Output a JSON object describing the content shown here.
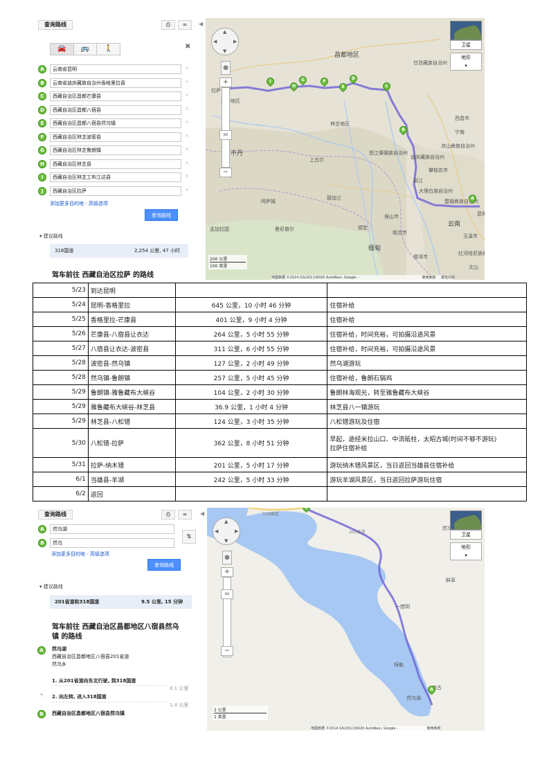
{
  "colors": {
    "route": "#6b62d6",
    "marker": "#6fbf3f",
    "button": "#4d90fe",
    "water": "#a7c8f2",
    "link": "#1155cc"
  },
  "shot1": {
    "panel": {
      "route_button": "查询路线",
      "print_icon": "print-icon",
      "link_icon": "link-icon",
      "modes": [
        "car-icon",
        "bus-icon",
        "walk-icon"
      ],
      "close_label": "✖",
      "waypoints": [
        {
          "letter": "A",
          "value": "云南省昆明"
        },
        {
          "letter": "B",
          "value": "云南省迪庆藏族自治州香格里拉县"
        },
        {
          "letter": "C",
          "value": "西藏自治区昌都芒康县"
        },
        {
          "letter": "D",
          "value": "西藏自治区昌都八宿县"
        },
        {
          "letter": "E",
          "value": "西藏自治区昌都八宿县然乌镇"
        },
        {
          "letter": "F",
          "value": "西藏自治区林芝波密县"
        },
        {
          "letter": "G",
          "value": "西藏自治区林芝鲁朗镇"
        },
        {
          "letter": "H",
          "value": "西藏自治区林芝县"
        },
        {
          "letter": "I",
          "value": "西藏自治区林芝工布江达县"
        },
        {
          "letter": "J",
          "value": "西藏自治区拉萨"
        }
      ],
      "add_destination": "添加更多目的地",
      "advanced": "高级选项",
      "search_button": "查询路线",
      "suggested": "建议路线",
      "route_name": "318国道",
      "route_summary": "2,254 公里, 47 小时",
      "drive_title": "驾车前往 西藏自治区拉萨 的路线"
    },
    "map": {
      "satellite": "卫星",
      "terrain": "地形",
      "scale_top": "200 公里",
      "scale_bottom": "100 英里",
      "footer": "地图数据 ©2014 GS(2011)6020 AutoNavi, Google -",
      "footer_right": "使用条款",
      "footer_report": "报告问题",
      "places": {
        "changdu": "昌都地区",
        "lasa": "拉萨",
        "shannan": "山南地区",
        "linzhi": "林芝地区",
        "lijiang": "丽江",
        "kunming": "昆明",
        "yunnan": "云南",
        "burma": "缅甸",
        "bhutan": "不丹",
        "dali": "大理白族自治州",
        "diqing": "迪庆藏族自治州",
        "yushu": "玉溪市",
        "xichang": "西昌市",
        "lhunze": "阿萨姆",
        "nagaland": "那加兰",
        "manipur": "曼尼普尔",
        "bangladesh": "孟加拉国",
        "dulong": "怒江傈僳族自治州",
        "ningnan": "宁南",
        "chuxiong": "楚雄彝族自治州",
        "honghe": "红河哈尼族彝族自治州",
        "puer": "普洱市",
        "sichuan": "凉山彝族自治州",
        "panzhihua": "攀枝花市",
        "ganzi": "甘孜藏族自治州",
        "shanggu": "上古尔",
        "baoshan": "保山市",
        "lincang": "临沧市",
        "dehong": "德宏",
        "wenshan": "文山"
      }
    }
  },
  "itinerary": [
    {
      "date": "5/23",
      "route": "到达昆明",
      "distance": "",
      "note": ""
    },
    {
      "date": "5/24",
      "route": "昆明-香格里拉",
      "distance": "645 公里，10 小时 46 分钟",
      "note": "住宿补给"
    },
    {
      "date": "5/25",
      "route": "香格里拉-芒康县",
      "distance": "401 公里，9 小时 4 分钟",
      "note": "住宿补给"
    },
    {
      "date": "5/26",
      "route": "芒康县-八宿县让衣达",
      "distance": "264 公里，5 小时 55 分钟",
      "note": "住宿补给，时间充裕，可拍摄沿途风景"
    },
    {
      "date": "5/27",
      "route": "八宿县让衣达-波密县",
      "distance": "311 公里，6 小时 55 分钟",
      "note": "住宿补给，时间充裕，可拍摄沿途风景"
    },
    {
      "date": "5/28",
      "route": "波密县-然乌镇",
      "distance": "127 公里，2 小时 49 分钟",
      "note": "然乌湖游玩"
    },
    {
      "date": "5/28",
      "route": "然乌镇-鲁朗镇",
      "distance": "257 公里，5 小时 45 分钟",
      "note": "住宿补给，鲁朗石锅鸡"
    },
    {
      "date": "5/29",
      "route": "鲁朗镇-雅鲁藏布大峡谷",
      "distance": "104 公里，2 小时 30 分钟",
      "note": "鲁朗林海观光，转至雅鲁藏布大峡谷"
    },
    {
      "date": "5/29",
      "route": "雅鲁藏布大峡谷-林芝县",
      "distance": "36.9 公里，1 小时 4 分钟",
      "note": "林芝县八一镇游玩"
    },
    {
      "date": "5/29",
      "route": "林芝县-八松错",
      "distance": "124 公里，3 小时 35 分钟",
      "note": "八松错游玩及住宿"
    },
    {
      "date": "5/30",
      "route": "八松错-拉萨",
      "distance": "362 公里，8 小时 51 分钟",
      "note": "早起，途经米拉山口、中流砥柱，太昭古城(时间不够不游玩)",
      "note2": "拉萨住宿补给"
    },
    {
      "date": "5/31",
      "route": "拉萨-纳木错",
      "distance": "201 公里，5 小时 17 分钟",
      "note": "游玩纳木错风景区，当日返回当雄县住宿补给"
    },
    {
      "date": "6/1",
      "route": "当雄县-羊湖",
      "distance": "242 公里，5 小时 33 分钟",
      "note": "游玩羊湖风景区，当日返回拉萨游玩住宿"
    },
    {
      "date": "6/2",
      "route": "返回",
      "distance": "",
      "note": ""
    }
  ],
  "shot2": {
    "panel": {
      "route_button": "查询路线",
      "waypoints": [
        {
          "letter": "A",
          "value": "然乌湖"
        },
        {
          "letter": "B",
          "value": "然乌"
        }
      ],
      "swap_icon": "swap-icon",
      "add_destination": "添加更多目的地",
      "advanced": "高级选项",
      "search_button": "查询路线",
      "suggested": "建议路线",
      "route_name": "201省道和318国道",
      "route_summary": "9.5 公里, 15 分钟",
      "drive_title_1": "驾车前往 西藏自治区昌都地区八宿县然乌",
      "drive_title_2": "镇 的路线",
      "start_name": "然乌湖",
      "start_addr_1": "西藏自治区昌都地区八宿县201省道",
      "start_addr_2": "然乌乡",
      "step1": "1. 从201省道向东北行驶, 到318国道",
      "step1_dist": "8.1 公里",
      "step2": "2. 向左转, 进入318国道",
      "step2_dist": "1.4 公里",
      "end_name": "西藏自治区昌都地区八宿县然乌镇"
    },
    "map": {
      "satellite": "卫星",
      "terrain": "地形",
      "road_318": "318国道",
      "road_201": "201省道",
      "places": {
        "ranwu_n": "然乌",
        "xianhua": "鲜草",
        "yicuo": "一措玥",
        "ayi": "呀勒",
        "ranwuhu": "然乌湖",
        "laigu": "来古"
      },
      "scale_top": "2 公里",
      "scale_bottom": "1 英里",
      "footer": "地图数据 ©2014 GS(2011)6020 AutoNavi, Google -",
      "footer_right": "使用条款"
    }
  }
}
